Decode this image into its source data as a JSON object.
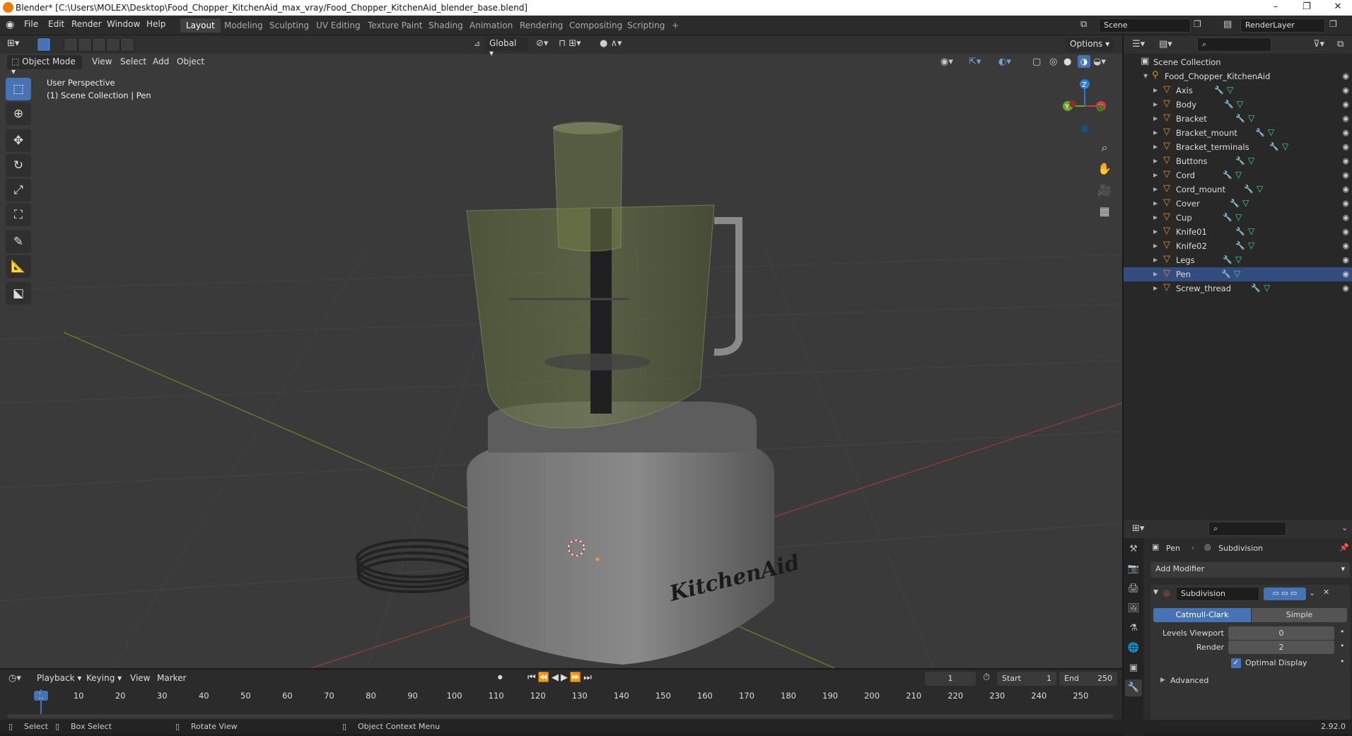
{
  "window": {
    "title": "Blender* [C:\\Users\\MOLEX\\Desktop\\Food_Chopper_KitchenAid_max_vray/Food_Chopper_KitchenAid_blender_base.blend]",
    "controls": [
      "–",
      "❐",
      "✕"
    ]
  },
  "menu": [
    "File",
    "Edit",
    "Render",
    "Window",
    "Help"
  ],
  "workspaces": [
    "Layout",
    "Modeling",
    "Sculpting",
    "UV Editing",
    "Texture Paint",
    "Shading",
    "Animation",
    "Rendering",
    "Compositing",
    "Scripting",
    "+"
  ],
  "active_workspace": "Layout",
  "scene": {
    "name": "Scene",
    "render_layer": "RenderLayer"
  },
  "viewport": {
    "transform_orientation": "Global",
    "options_label": "Options",
    "mode": "Object Mode",
    "header_menus": [
      "View",
      "Select",
      "Add",
      "Object"
    ],
    "perspective_label": "User Perspective",
    "collection_label": "(1) Scene Collection | Pen",
    "gizmo": {
      "x": "X",
      "y": "Y",
      "z": "Z"
    },
    "logo_text": "KitchenAid"
  },
  "icons": {
    "tools": [
      "select-box-icon",
      "cursor-icon",
      "move-icon",
      "rotate-icon",
      "scale-icon",
      "transform-icon",
      "annotate-icon",
      "measure-icon",
      "add-cube-icon"
    ],
    "nav": [
      "zoom-icon",
      "pan-hand-icon",
      "camera-icon",
      "grid-icon"
    ]
  },
  "outliner": {
    "root": "Scene Collection",
    "collection": "Food_Chopper_KitchenAid",
    "items": [
      "Axis",
      "Body",
      "Bracket",
      "Bracket_mount",
      "Bracket_terminals",
      "Buttons",
      "Cord",
      "Cord_mount",
      "Cover",
      "Cup",
      "Knife01",
      "Knife02",
      "Legs",
      "Pen",
      "Screw_thread"
    ],
    "selected": "Pen"
  },
  "properties": {
    "object": "Pen",
    "modifier_context": "Subdivision",
    "add_modifier": "Add Modifier",
    "modifier_name": "Subdivision",
    "algorithm": {
      "options": [
        "Catmull-Clark",
        "Simple"
      ],
      "selected": "Catmull-Clark"
    },
    "levels_viewport_label": "Levels Viewport",
    "levels_viewport": "0",
    "render_label": "Render",
    "render": "2",
    "optimal_display_label": "Optimal Display",
    "optimal_display": true,
    "advanced_label": "Advanced"
  },
  "timeline": {
    "menus": [
      "Playback",
      "Keying",
      "View",
      "Marker"
    ],
    "current_frame": "1",
    "start_label": "Start",
    "start": "1",
    "end_label": "End",
    "end": "250",
    "ticks": [
      "1",
      "10",
      "20",
      "30",
      "40",
      "50",
      "60",
      "70",
      "80",
      "90",
      "100",
      "110",
      "120",
      "130",
      "140",
      "150",
      "160",
      "170",
      "180",
      "190",
      "200",
      "210",
      "220",
      "230",
      "240",
      "250"
    ]
  },
  "status": {
    "select": "Select",
    "box_select": "Box Select",
    "rotate_view": "Rotate View",
    "context_menu": "Object Context Menu",
    "version": "2.92.0"
  }
}
